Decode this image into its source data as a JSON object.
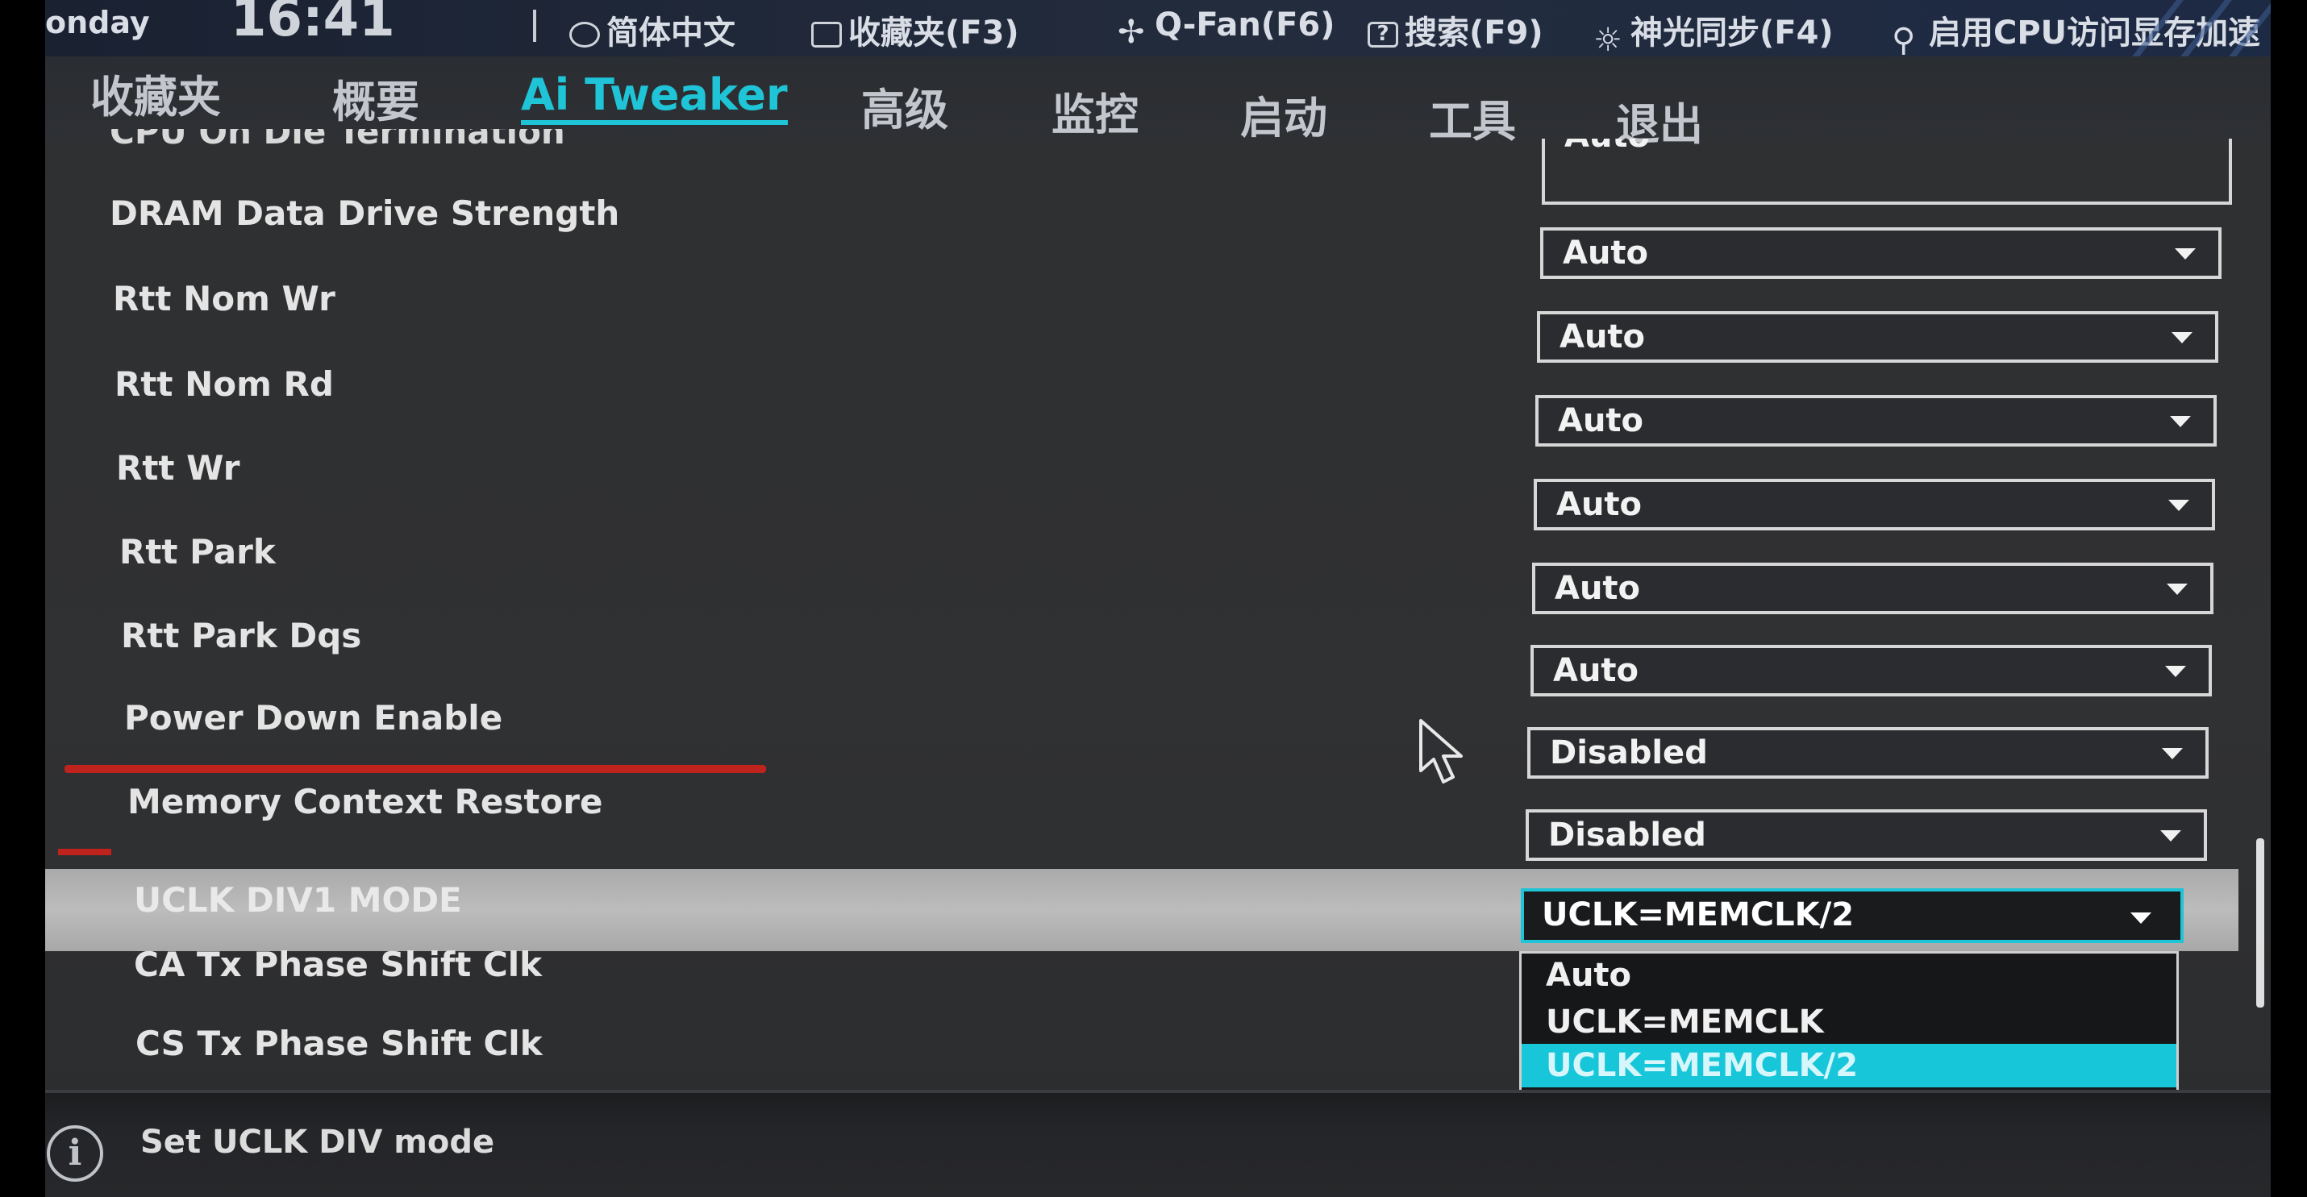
{
  "topbar": {
    "day": "onday",
    "clock": "16:41",
    "language": "简体中文",
    "favorites": "收藏夹(F3)",
    "qfan": "Q-Fan(F6)",
    "search": "搜索(F9)",
    "aura": "神光同步(F4)",
    "resizable_bar": "启用CPU访问显存加速"
  },
  "nav": {
    "tabs": [
      "收藏夹",
      "概要",
      "Ai Tweaker",
      "高级",
      "监控",
      "启动",
      "工具",
      "退出"
    ],
    "active": "Ai Tweaker"
  },
  "settings": {
    "partial_label": "CPU On Die Termination",
    "partial_value": "Auto",
    "rows": [
      {
        "label": "DRAM Data Drive Strength",
        "value": "Auto"
      },
      {
        "label": "Rtt Nom Wr",
        "value": "Auto"
      },
      {
        "label": "Rtt Nom Rd",
        "value": "Auto"
      },
      {
        "label": "Rtt Wr",
        "value": "Auto"
      },
      {
        "label": "Rtt Park",
        "value": "Auto"
      },
      {
        "label": "Rtt Park Dqs",
        "value": "Auto"
      },
      {
        "label": "Power Down Enable",
        "value": "Disabled"
      },
      {
        "label": "Memory Context Restore",
        "value": "Disabled"
      }
    ],
    "highlighted": {
      "label": "UCLK DIV1 MODE",
      "value": "UCLK=MEMCLK/2"
    },
    "after": [
      {
        "label": "CA Tx Phase Shift Clk"
      },
      {
        "label": "CS Tx Phase Shift Clk"
      }
    ]
  },
  "dropdown_options": [
    "Auto",
    "UCLK=MEMCLK",
    "UCLK=MEMCLK/2"
  ],
  "selected_option_index": 2,
  "help": {
    "text": "Set UCLK DIV mode"
  },
  "colors": {
    "accent": "#1fc4d7",
    "highlight_row": "#b5b5b5",
    "underline_red": "#c0231d"
  },
  "icons": {
    "info": "info-icon",
    "cursor": "mouse-pointer-icon"
  }
}
